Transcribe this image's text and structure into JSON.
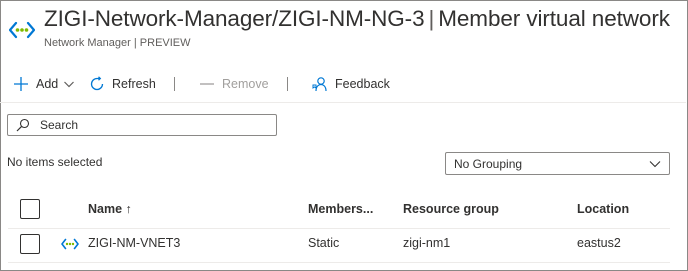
{
  "header": {
    "title_path": "ZIGI-Network-Manager/ZIGI-NM-NG-3",
    "title_separator": "|",
    "title_section": "Member virtual network",
    "subtitle": "Network Manager | PREVIEW",
    "icon": "network-manager-icon"
  },
  "toolbar": {
    "add_label": "Add",
    "refresh_label": "Refresh",
    "remove_label": "Remove",
    "feedback_label": "Feedback"
  },
  "search": {
    "placeholder": "Search"
  },
  "selection": {
    "status": "No items selected"
  },
  "grouping": {
    "selected": "No Grouping"
  },
  "table": {
    "columns": {
      "name": "Name ↑",
      "members": "Members...",
      "resource_group": "Resource group",
      "location": "Location"
    },
    "rows": [
      {
        "name": "ZIGI-NM-VNET3",
        "members": "Static",
        "resource_group": "zigi-nm1",
        "location": "eastus2"
      }
    ]
  },
  "colors": {
    "accent": "#0078d4",
    "vnet_green": "#7fba00",
    "text": "#323130",
    "subtle_text": "#605e5c",
    "disabled": "#a19f9d",
    "border": "#8a8886"
  }
}
